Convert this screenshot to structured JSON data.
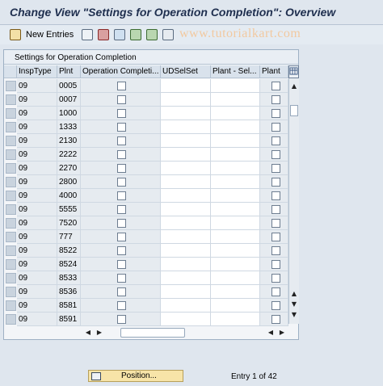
{
  "window": {
    "title": "Change View \"Settings for Operation Completion\": Overview"
  },
  "toolbar": {
    "new_entries_label": "New Entries",
    "icons": [
      "edit-pencil-icon",
      "copy-icon",
      "delete-icon",
      "undo-icon",
      "select-all-icon",
      "select-block-icon",
      "deselect-all-icon"
    ]
  },
  "watermark": "www.tutorialkart.com",
  "table": {
    "title": "Settings for Operation Completion",
    "columns": [
      "InspType",
      "Plnt",
      "Operation Completi...",
      "UDSelSet",
      "Plant - Sel...",
      "Plant"
    ],
    "rows": [
      {
        "insptype": "09",
        "plnt": "0005"
      },
      {
        "insptype": "09",
        "plnt": "0007"
      },
      {
        "insptype": "09",
        "plnt": "1000"
      },
      {
        "insptype": "09",
        "plnt": "1333"
      },
      {
        "insptype": "09",
        "plnt": "2130"
      },
      {
        "insptype": "09",
        "plnt": "2222"
      },
      {
        "insptype": "09",
        "plnt": "2270"
      },
      {
        "insptype": "09",
        "plnt": "2800"
      },
      {
        "insptype": "09",
        "plnt": "4000"
      },
      {
        "insptype": "09",
        "plnt": "5555"
      },
      {
        "insptype": "09",
        "plnt": "7520"
      },
      {
        "insptype": "09",
        "plnt": "777"
      },
      {
        "insptype": "09",
        "plnt": "8522"
      },
      {
        "insptype": "09",
        "plnt": "8524"
      },
      {
        "insptype": "09",
        "plnt": "8533"
      },
      {
        "insptype": "09",
        "plnt": "8536"
      },
      {
        "insptype": "09",
        "plnt": "8581"
      },
      {
        "insptype": "09",
        "plnt": "8591"
      }
    ]
  },
  "footer": {
    "position_label": "Position...",
    "entry_text": "Entry 1 of 42"
  },
  "colors": {
    "background": "#dfe6ee",
    "title_text": "#1f2f4f",
    "position_button": "#f7e4a8",
    "watermark": "#f2c9a0"
  }
}
